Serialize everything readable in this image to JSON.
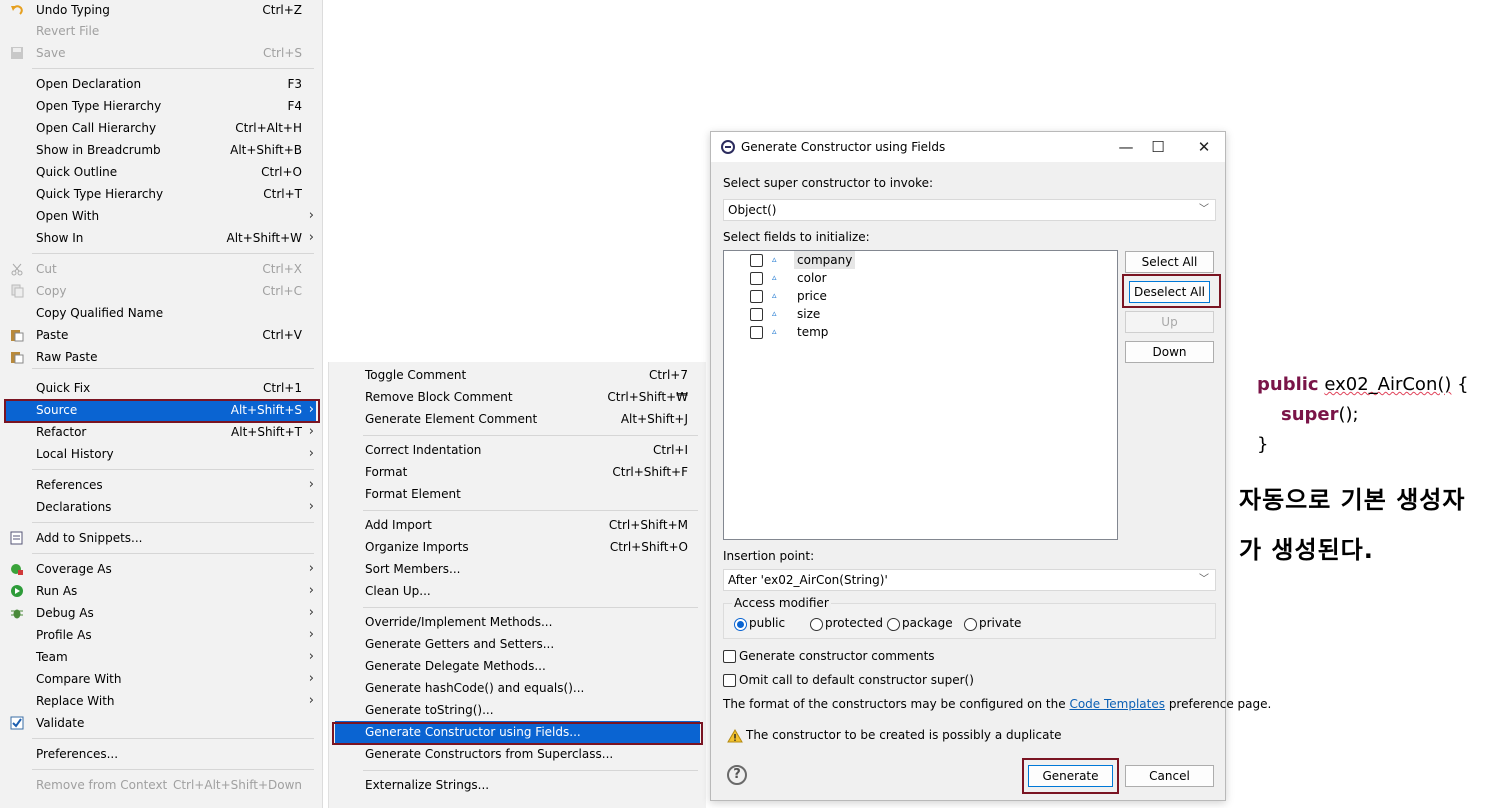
{
  "menu": {
    "items": [
      {
        "id": "undo-typing",
        "label": "Undo Typing",
        "shortcut": "Ctrl+Z",
        "icon": "undo-icon"
      },
      {
        "id": "revert-file",
        "label": "Revert File",
        "disabled": true
      },
      {
        "id": "save",
        "label": "Save",
        "shortcut": "Ctrl+S",
        "disabled": true,
        "icon": "save-icon"
      },
      {
        "id": "open-declaration",
        "label": "Open Declaration",
        "shortcut": "F3"
      },
      {
        "id": "open-type-hierarchy",
        "label": "Open Type Hierarchy",
        "shortcut": "F4"
      },
      {
        "id": "open-call-hierarchy",
        "label": "Open Call Hierarchy",
        "shortcut": "Ctrl+Alt+H"
      },
      {
        "id": "show-in-breadcrumb",
        "label": "Show in Breadcrumb",
        "shortcut": "Alt+Shift+B"
      },
      {
        "id": "quick-outline",
        "label": "Quick Outline",
        "shortcut": "Ctrl+O"
      },
      {
        "id": "quick-type-hierarchy",
        "label": "Quick Type Hierarchy",
        "shortcut": "Ctrl+T"
      },
      {
        "id": "open-with",
        "label": "Open With",
        "submenu": true
      },
      {
        "id": "show-in",
        "label": "Show In",
        "shortcut": "Alt+Shift+W",
        "submenu": true
      },
      {
        "id": "cut",
        "label": "Cut",
        "shortcut": "Ctrl+X",
        "disabled": true,
        "icon": "cut-icon"
      },
      {
        "id": "copy",
        "label": "Copy",
        "shortcut": "Ctrl+C",
        "disabled": true,
        "icon": "copy-icon"
      },
      {
        "id": "copy-qualified-name",
        "label": "Copy Qualified Name"
      },
      {
        "id": "paste",
        "label": "Paste",
        "shortcut": "Ctrl+V",
        "icon": "paste-icon"
      },
      {
        "id": "raw-paste",
        "label": "Raw Paste",
        "icon": "paste-icon"
      },
      {
        "id": "quick-fix",
        "label": "Quick Fix",
        "shortcut": "Ctrl+1"
      },
      {
        "id": "source",
        "label": "Source",
        "shortcut": "Alt+Shift+S",
        "submenu": true,
        "selected": true
      },
      {
        "id": "refactor",
        "label": "Refactor",
        "shortcut": "Alt+Shift+T",
        "submenu": true
      },
      {
        "id": "local-history",
        "label": "Local History",
        "submenu": true
      },
      {
        "id": "references",
        "label": "References",
        "submenu": true
      },
      {
        "id": "declarations",
        "label": "Declarations",
        "submenu": true
      },
      {
        "id": "add-to-snippets",
        "label": "Add to Snippets...",
        "icon": "snippet-icon"
      },
      {
        "id": "coverage-as",
        "label": "Coverage As",
        "submenu": true,
        "icon": "coverage-icon"
      },
      {
        "id": "run-as",
        "label": "Run As",
        "submenu": true,
        "icon": "run-icon"
      },
      {
        "id": "debug-as",
        "label": "Debug As",
        "submenu": true,
        "icon": "bug-icon"
      },
      {
        "id": "profile-as",
        "label": "Profile As",
        "submenu": true
      },
      {
        "id": "team",
        "label": "Team",
        "submenu": true
      },
      {
        "id": "compare-with",
        "label": "Compare With",
        "submenu": true
      },
      {
        "id": "replace-with",
        "label": "Replace With",
        "submenu": true
      },
      {
        "id": "validate",
        "label": "Validate",
        "icon": "checkmark-icon"
      },
      {
        "id": "preferences",
        "label": "Preferences..."
      },
      {
        "id": "remove-from-context",
        "label": "Remove from Context",
        "shortcut": "Ctrl+Alt+Shift+Down",
        "disabled": true
      }
    ]
  },
  "submenu": {
    "items": [
      {
        "id": "toggle-comment",
        "label": "Toggle Comment",
        "shortcut": "Ctrl+7"
      },
      {
        "id": "remove-block-comment",
        "label": "Remove Block Comment",
        "shortcut": "Ctrl+Shift+₩"
      },
      {
        "id": "generate-element-comment",
        "label": "Generate Element Comment",
        "shortcut": "Alt+Shift+J"
      },
      {
        "id": "correct-indentation",
        "label": "Correct Indentation",
        "shortcut": "Ctrl+I"
      },
      {
        "id": "format",
        "label": "Format",
        "shortcut": "Ctrl+Shift+F"
      },
      {
        "id": "format-element",
        "label": "Format Element"
      },
      {
        "id": "add-import",
        "label": "Add Import",
        "shortcut": "Ctrl+Shift+M"
      },
      {
        "id": "organize-imports",
        "label": "Organize Imports",
        "shortcut": "Ctrl+Shift+O"
      },
      {
        "id": "sort-members",
        "label": "Sort Members..."
      },
      {
        "id": "clean-up",
        "label": "Clean Up..."
      },
      {
        "id": "override-implement-methods",
        "label": "Override/Implement Methods..."
      },
      {
        "id": "generate-getters-setters",
        "label": "Generate Getters and Setters..."
      },
      {
        "id": "generate-delegate-methods",
        "label": "Generate Delegate Methods..."
      },
      {
        "id": "generate-hashcode-equals",
        "label": "Generate hashCode() and equals()..."
      },
      {
        "id": "generate-tostring",
        "label": "Generate toString()..."
      },
      {
        "id": "generate-constructor-using-fields",
        "label": "Generate Constructor using Fields...",
        "selected": true
      },
      {
        "id": "generate-constructors-from-superclass",
        "label": "Generate Constructors from Superclass..."
      },
      {
        "id": "externalize-strings",
        "label": "Externalize Strings..."
      }
    ]
  },
  "dialog": {
    "title": "Generate Constructor using Fields",
    "super_label": "Select super constructor to invoke:",
    "super_value": "Object()",
    "fields_label": "Select fields to initialize:",
    "fields": [
      {
        "name": "company",
        "checked": false
      },
      {
        "name": "color",
        "checked": false
      },
      {
        "name": "price",
        "checked": false
      },
      {
        "name": "size",
        "checked": false
      },
      {
        "name": "temp",
        "checked": false
      }
    ],
    "select_all": "Select All",
    "deselect_all": "Deselect All",
    "up": "Up",
    "down": "Down",
    "insertion_label": "Insertion point:",
    "insertion_value": "After 'ex02_AirCon(String)'",
    "access_label": "Access modifier",
    "modifiers": [
      "public",
      "protected",
      "package",
      "private"
    ],
    "selected_modifier": "public",
    "gen_comments": "Generate constructor comments",
    "omit_super": "Omit call to default constructor super()",
    "format_text_pre": "The format of the constructors may be configured on the",
    "code_templates": "Code Templates",
    "format_text_post": "preference page.",
    "warning": "The constructor to be created is possibly a duplicate",
    "generate": "Generate",
    "cancel": "Cancel"
  },
  "annotation": {
    "code_kw_public": "public",
    "code_name": "ex02_AirCon()",
    "code_brace_open": "{",
    "code_kw_super": "super",
    "code_call": "();",
    "code_brace_close": "}",
    "note_line1": "자동으로 기본 생성자",
    "note_line2": "가 생성된다."
  },
  "colors": {
    "selection": "#0a64d2",
    "highlight_box": "#7a1422",
    "keyword": "#7a1448",
    "link": "#0a5fb4"
  }
}
